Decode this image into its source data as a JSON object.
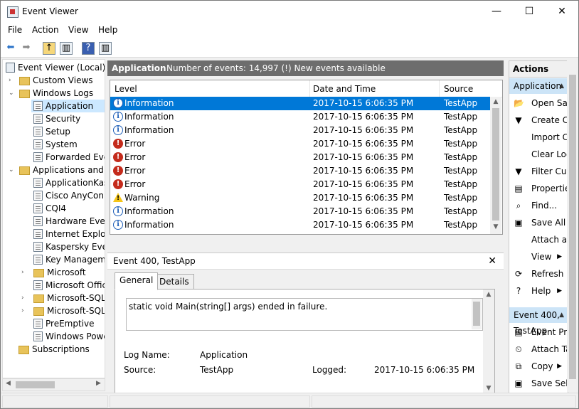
{
  "window": {
    "title": "Event Viewer",
    "minimize": "—",
    "maximize": "☐",
    "close": "✕"
  },
  "menu": [
    "File",
    "Action",
    "View",
    "Help"
  ],
  "tree": {
    "root": "Event Viewer (Local)",
    "custom_views": "Custom Views",
    "windows_logs": "Windows Logs",
    "windows_log_items": [
      "Application",
      "Security",
      "Setup",
      "System",
      "Forwarded Events"
    ],
    "apps_services": "Applications and Services Logs",
    "apps_items": [
      "ApplicationKaspersky",
      "Cisco AnyConnect",
      "CQI4",
      "Hardware Events",
      "Internet Explorer",
      "Kaspersky Event",
      "Key Management",
      "Microsoft",
      "Microsoft Office",
      "Microsoft-SQLServer",
      "Microsoft-SQLServer",
      "PreEmptive",
      "Windows PowerShell"
    ],
    "subscriptions": "Subscriptions"
  },
  "log_header": {
    "name": "Application",
    "summary": "Number of events: 14,997 (!) New events available"
  },
  "columns": {
    "level": "Level",
    "date": "Date and Time",
    "source": "Source"
  },
  "events": [
    {
      "level": "Information",
      "icon": "info",
      "date": "2017-10-15 6:06:35 PM",
      "source": "TestApp"
    },
    {
      "level": "Information",
      "icon": "info",
      "date": "2017-10-15 6:06:35 PM",
      "source": "TestApp"
    },
    {
      "level": "Information",
      "icon": "info",
      "date": "2017-10-15 6:06:35 PM",
      "source": "TestApp"
    },
    {
      "level": "Error",
      "icon": "error",
      "date": "2017-10-15 6:06:35 PM",
      "source": "TestApp"
    },
    {
      "level": "Error",
      "icon": "error",
      "date": "2017-10-15 6:06:35 PM",
      "source": "TestApp"
    },
    {
      "level": "Error",
      "icon": "error",
      "date": "2017-10-15 6:06:35 PM",
      "source": "TestApp"
    },
    {
      "level": "Error",
      "icon": "error",
      "date": "2017-10-15 6:06:35 PM",
      "source": "TestApp"
    },
    {
      "level": "Warning",
      "icon": "warning",
      "date": "2017-10-15 6:06:35 PM",
      "source": "TestApp"
    },
    {
      "level": "Information",
      "icon": "info",
      "date": "2017-10-15 6:06:35 PM",
      "source": "TestApp"
    },
    {
      "level": "Information",
      "icon": "info",
      "date": "2017-10-15 6:06:35 PM",
      "source": "TestApp"
    }
  ],
  "selected_event_index": 0,
  "detail": {
    "title": "Event 400, TestApp",
    "close": "✕",
    "tabs": [
      "General",
      "Details"
    ],
    "message": "static void Main(string[] args) ended in failure.",
    "log_name_label": "Log Name:",
    "log_name_value": "Application",
    "source_label": "Source:",
    "source_value": "TestApp",
    "logged_label": "Logged:",
    "logged_value": "2017-10-15 6:06:35 PM"
  },
  "actions": {
    "header": "Actions",
    "section1": "Application",
    "section1_items": [
      {
        "label": "Open Saved Log...",
        "icon": "open-folder-icon",
        "glyph": "📂"
      },
      {
        "label": "Create Custom View...",
        "icon": "filter-icon",
        "glyph": "▼"
      },
      {
        "label": "Import Custom View...",
        "icon": "",
        "glyph": ""
      },
      {
        "label": "Clear Log...",
        "icon": "",
        "glyph": ""
      },
      {
        "label": "Filter Current Log...",
        "icon": "filter-icon",
        "glyph": "▼"
      },
      {
        "label": "Properties",
        "icon": "properties-icon",
        "glyph": "▤"
      },
      {
        "label": "Find...",
        "icon": "binoculars-icon",
        "glyph": "⌕"
      },
      {
        "label": "Save All Events As...",
        "icon": "save-icon",
        "glyph": "▣"
      },
      {
        "label": "Attach a Task To this Log...",
        "icon": "",
        "glyph": ""
      },
      {
        "label": "View",
        "icon": "",
        "glyph": "",
        "submenu": true
      },
      {
        "label": "Refresh",
        "icon": "refresh-icon",
        "glyph": "⟳"
      },
      {
        "label": "Help",
        "icon": "help-icon",
        "glyph": "?",
        "submenu": true
      }
    ],
    "section2": "Event 400, TestApp",
    "section2_items": [
      {
        "label": "Event Properties",
        "icon": "properties-icon",
        "glyph": "▤"
      },
      {
        "label": "Attach Task To This Event...",
        "icon": "task-icon",
        "glyph": "⏲"
      },
      {
        "label": "Copy",
        "icon": "copy-icon",
        "glyph": "⧉",
        "submenu": true
      },
      {
        "label": "Save Selected Events...",
        "icon": "save-icon",
        "glyph": "▣"
      }
    ]
  }
}
